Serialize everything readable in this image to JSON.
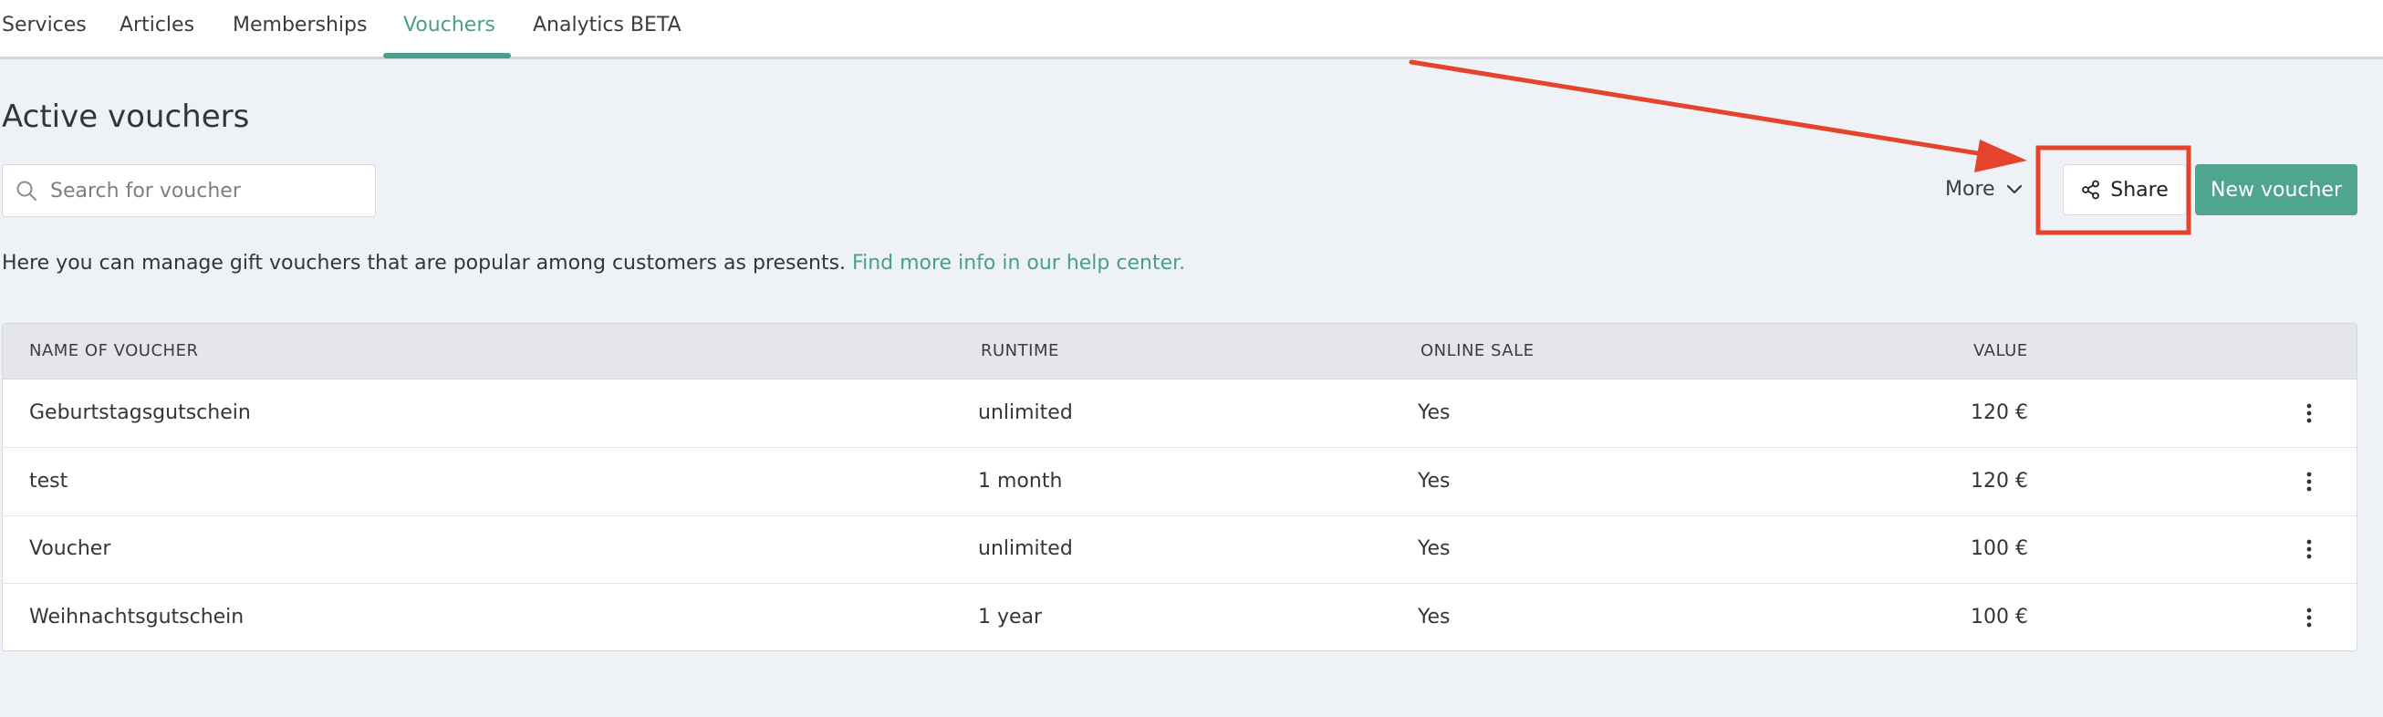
{
  "nav": {
    "tabs": [
      {
        "label": "Services"
      },
      {
        "label": "Articles"
      },
      {
        "label": "Memberships"
      },
      {
        "label": "Vouchers"
      },
      {
        "label": "Analytics BETA"
      }
    ]
  },
  "page": {
    "title": "Active vouchers",
    "search_placeholder": "Search for voucher",
    "more_label": "More",
    "share_label": "Share",
    "new_voucher_label": "New voucher",
    "info_text": "Here you can manage gift vouchers that are popular among customers as presents.",
    "info_link": "Find more info in our help center."
  },
  "table": {
    "headers": [
      "NAME OF VOUCHER",
      "RUNTIME",
      "ONLINE SALE",
      "VALUE"
    ],
    "rows": [
      {
        "name": "Geburtstagsgutschein",
        "runtime": "unlimited",
        "online_sale": "Yes",
        "value": "120 €"
      },
      {
        "name": "test",
        "runtime": "1 month",
        "online_sale": "Yes",
        "value": "120 €"
      },
      {
        "name": "Voucher",
        "runtime": "unlimited",
        "online_sale": "Yes",
        "value": "100 €"
      },
      {
        "name": "Weihnachtsgutschein",
        "runtime": "1 year",
        "online_sale": "Yes",
        "value": "100 €"
      }
    ]
  },
  "colors": {
    "accent": "#4a9e8a",
    "annotation": "#e5432d"
  },
  "icons": [
    "search-icon",
    "chevron-down-icon",
    "share-icon",
    "kebab-menu-icon"
  ]
}
